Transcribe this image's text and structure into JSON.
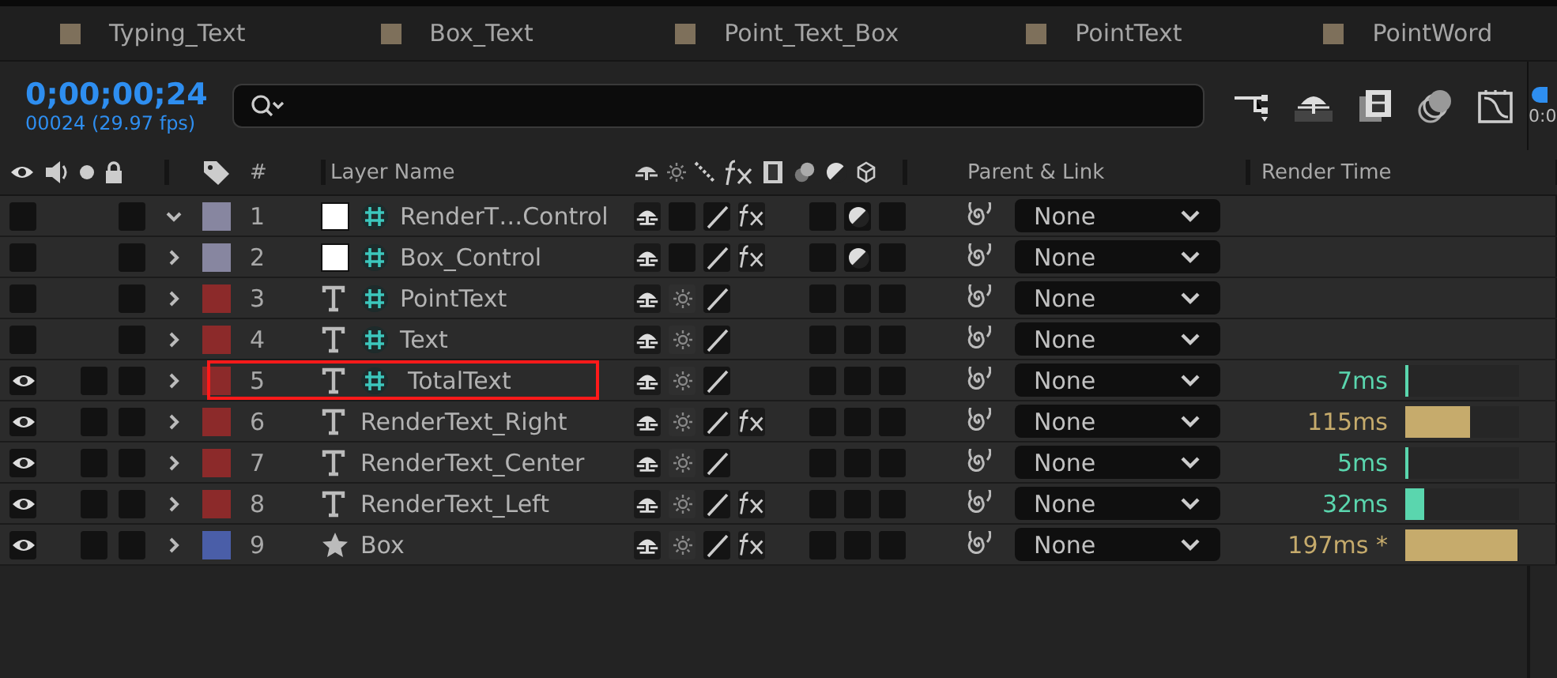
{
  "tabs": [
    {
      "label": "Typing_Text"
    },
    {
      "label": "Box_Text"
    },
    {
      "label": "Point_Text_Box"
    },
    {
      "label": "PointText"
    },
    {
      "label": "PointWord"
    }
  ],
  "timecode": "0;00;00;24",
  "frame_info": "00024 (29.97 fps)",
  "ruler_label": "0:0",
  "columns": {
    "number": "#",
    "layer_name": "Layer Name",
    "parent": "Parent & Link",
    "render_time": "Render Time"
  },
  "layers": [
    {
      "number": "1",
      "name": "RenderT…Control",
      "kind": "solid",
      "expression": true,
      "expanded": true,
      "visible": false,
      "locked": false,
      "color": "#8786a0",
      "fx": true,
      "collapse": false,
      "motion_blur": false,
      "adjustment": true,
      "three_d": false,
      "parent": "None",
      "highlighted": false
    },
    {
      "number": "2",
      "name": "Box_Control",
      "kind": "solid",
      "expression": true,
      "expanded": false,
      "visible": false,
      "locked": false,
      "color": "#8786a0",
      "fx": true,
      "collapse": false,
      "motion_blur": false,
      "adjustment": true,
      "three_d": false,
      "parent": "None",
      "highlighted": false
    },
    {
      "number": "3",
      "name": "PointText",
      "kind": "text",
      "expression": true,
      "expanded": false,
      "visible": false,
      "locked": false,
      "color": "#8c2a2a",
      "fx": false,
      "collapse": true,
      "motion_blur": false,
      "adjustment": false,
      "three_d": false,
      "parent": "None",
      "highlighted": false
    },
    {
      "number": "4",
      "name": "Text",
      "kind": "text",
      "expression": true,
      "expanded": false,
      "visible": false,
      "locked": false,
      "color": "#8c2a2a",
      "fx": false,
      "collapse": true,
      "motion_blur": false,
      "adjustment": false,
      "three_d": false,
      "parent": "None",
      "highlighted": false
    },
    {
      "number": "5",
      "name": "TotalText",
      "kind": "text",
      "expression": true,
      "expanded": false,
      "visible": true,
      "solo": false,
      "locked": false,
      "color": "#8c2a2a",
      "fx": false,
      "collapse": true,
      "motion_blur": false,
      "adjustment": false,
      "three_d": false,
      "parent": "None",
      "highlighted": true,
      "render": {
        "time": "7ms",
        "color": "#5ad6ae",
        "level": 0.03
      }
    },
    {
      "number": "6",
      "name": "RenderText_Right",
      "kind": "text",
      "expression": false,
      "expanded": false,
      "visible": true,
      "solo": false,
      "locked": false,
      "color": "#8c2a2a",
      "fx": true,
      "collapse": true,
      "motion_blur": false,
      "adjustment": false,
      "three_d": false,
      "parent": "None",
      "highlighted": false,
      "render": {
        "time": "115ms",
        "color": "#c6ab6c",
        "level": 0.575
      }
    },
    {
      "number": "7",
      "name": "RenderText_Center",
      "kind": "text",
      "expression": false,
      "expanded": false,
      "visible": true,
      "solo": false,
      "locked": false,
      "color": "#8c2a2a",
      "fx": false,
      "collapse": true,
      "motion_blur": false,
      "adjustment": false,
      "three_d": false,
      "parent": "None",
      "highlighted": false,
      "render": {
        "time": "5ms",
        "color": "#5ad6ae",
        "level": 0.025
      }
    },
    {
      "number": "8",
      "name": "RenderText_Left",
      "kind": "text",
      "expression": false,
      "expanded": false,
      "visible": true,
      "solo": false,
      "locked": false,
      "color": "#8c2a2a",
      "fx": true,
      "collapse": true,
      "motion_blur": false,
      "adjustment": false,
      "three_d": false,
      "parent": "None",
      "highlighted": false,
      "render": {
        "time": "32ms",
        "color": "#5ad6ae",
        "level": 0.16
      }
    },
    {
      "number": "9",
      "name": "Box",
      "kind": "shape",
      "expression": false,
      "expanded": false,
      "visible": true,
      "solo": false,
      "locked": false,
      "color": "#4a5ea8",
      "fx": true,
      "collapse": true,
      "motion_blur": false,
      "adjustment": false,
      "three_d": false,
      "parent": "None",
      "highlighted": false,
      "render": {
        "time": "197ms *",
        "color": "#c6ab6c",
        "level": 0.985
      }
    }
  ]
}
